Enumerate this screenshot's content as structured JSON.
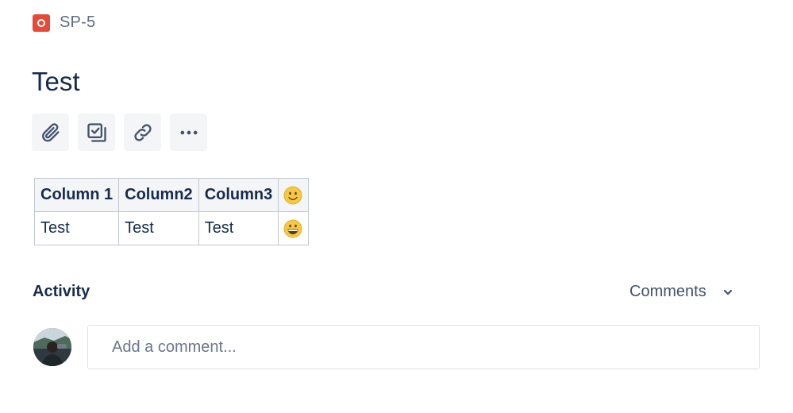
{
  "issue": {
    "key": "SP-5",
    "type_icon": "bug-icon",
    "summary": "Test"
  },
  "toolbar": {
    "buttons": [
      {
        "name": "attach-button",
        "icon": "paperclip-icon"
      },
      {
        "name": "create-subtask-button",
        "icon": "subtask-icon"
      },
      {
        "name": "link-issue-button",
        "icon": "link-icon"
      },
      {
        "name": "more-actions-button",
        "icon": "ellipsis-icon"
      }
    ]
  },
  "table": {
    "headers": [
      "Column 1",
      "Column2",
      "Column3"
    ],
    "header_emoji": "slightly-smiling-face-emoji",
    "rows": [
      {
        "cells": [
          "Test",
          "Test",
          "Test"
        ],
        "emoji": "grinning-face-emoji"
      }
    ]
  },
  "activity": {
    "title": "Activity",
    "filter_label": "Comments",
    "comment_placeholder": "Add a comment..."
  },
  "colors": {
    "bug_red": "#E5493A",
    "text_primary": "#172B4D",
    "text_secondary": "#5E6C84",
    "button_bg": "#F4F5F7"
  }
}
